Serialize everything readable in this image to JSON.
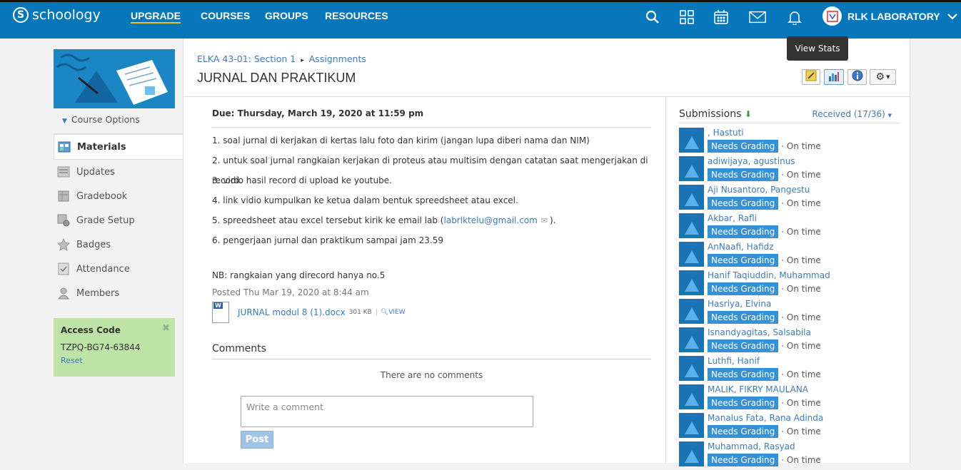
{
  "topbar": {
    "logo": "schoology",
    "nav": [
      "UPGRADE",
      "COURSES",
      "GROUPS",
      "RESOURCES"
    ],
    "icons": [
      "search-icon",
      "apps-grid-icon",
      "calendar-icon",
      "mail-icon",
      "notifications-bell-icon"
    ],
    "user_name": "RLK LABORATORY",
    "colors": {
      "bar": "#0677ba",
      "upgrade_underline": "#f0c12a"
    }
  },
  "left": {
    "course_options": "Course Options",
    "menu": [
      "Materials",
      "Updates",
      "Gradebook",
      "Grade Setup",
      "Badges",
      "Attendance",
      "Members"
    ],
    "access": {
      "title": "Access Code",
      "code": "TZPQ-BG74-63844",
      "reset": "Reset"
    }
  },
  "page": {
    "breadcrumb_course": "ELKA 43-01: Section 1",
    "breadcrumb_sep": "▸",
    "breadcrumb_section": "Assignments",
    "title": "JURNAL DAN PRAKTIKUM",
    "tooltip": "View Stats"
  },
  "assignment": {
    "due": "Due: Thursday, March 19, 2020 at 11:59 pm",
    "instructions": [
      "1. soal jurnal di kerjakan di kertas lalu foto dan kirim (jangan lupa diberi nama dan NIM)",
      "2. untuk soal jurnal rangkaian kerjakan di proteus atau multisim dengan catatan saat mengerjakan di record.",
      "3. vidio hasil record di upload ke youtube.",
      "4. link vidio kumpulkan ke ketua dalam bentuk spreedsheet atau excel."
    ],
    "line5_pre": "5. spreedsheet atau excel tersebut kirik ke email lab (",
    "line5_email": "labrlktelu@gmail.com",
    "line5_post": ").",
    "line6": "6. pengerjaan jurnal dan praktikum sampai jam 23.59",
    "nb": "NB: rangkaian yang direcord hanya no.5",
    "posted": "Posted Thu Mar 19, 2020 at 8:44 am",
    "attachment": {
      "name": "JURNAL modul 8 (1).docx",
      "size": "301 KB",
      "view": "VIEW"
    }
  },
  "comments": {
    "heading": "Comments",
    "empty": "There are no comments",
    "placeholder": "Write a comment",
    "post": "Post"
  },
  "submissions": {
    "title": "Submissions",
    "received": "Received (17/36)",
    "status_label": "Needs Grading",
    "ontime": "· On time",
    "students": [
      ", Hastuti",
      "adiwijaya, agustinus",
      "Aji Nusantoro, Pangestu",
      "Akbar, Rafli",
      "AnNaafi, Hafidz",
      "Hanif Taqiuddin, Muhammad",
      "Hasriya, Elvina",
      "Isnandyagitas, Salsabila",
      "Luthfi, Hanif",
      "MALIK, FIKRY MAULANA",
      "Manalus Fata, Rana Adinda",
      "Muhammad, Rasyad"
    ]
  }
}
